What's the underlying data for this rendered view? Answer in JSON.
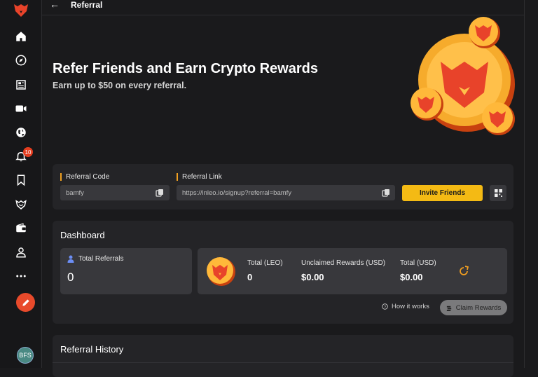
{
  "header": {
    "back_icon": "arrow-left-icon",
    "title": "Referral"
  },
  "sidebar": {
    "items": [
      {
        "name": "home",
        "icon": "home-icon"
      },
      {
        "name": "explore",
        "icon": "compass-icon"
      },
      {
        "name": "news",
        "icon": "newspaper-icon"
      },
      {
        "name": "video",
        "icon": "video-icon"
      },
      {
        "name": "globe",
        "icon": "globe-icon"
      },
      {
        "name": "notifications",
        "icon": "bell-icon"
      },
      {
        "name": "bookmarks",
        "icon": "bookmark-icon"
      },
      {
        "name": "leo",
        "icon": "leo-icon"
      },
      {
        "name": "wallet",
        "icon": "wallet-icon"
      },
      {
        "name": "profile",
        "icon": "user-icon"
      },
      {
        "name": "more",
        "icon": "more-icon"
      }
    ],
    "notification_count": "10",
    "avatar_text": "BFS",
    "accent": "#e84a2b"
  },
  "hero": {
    "title": "Refer Friends and Earn Crypto Rewards",
    "subtitle": "Earn up to $50 on every referral."
  },
  "referral": {
    "code_label": "Referral Code",
    "code_value": "bamfy",
    "link_label": "Referral Link",
    "link_value": "https://inleo.io/signup?referral=bamfy",
    "invite_label": "Invite Friends",
    "invite_color": "#f4ba14"
  },
  "dashboard": {
    "title": "Dashboard",
    "total_referrals_label": "Total Referrals",
    "total_referrals_value": "0",
    "total_leo_label": "Total (LEO)",
    "total_leo_value": "0",
    "unclaimed_label": "Unclaimed Rewards (USD)",
    "unclaimed_value": "$0.00",
    "total_usd_label": "Total (USD)",
    "total_usd_value": "$0.00",
    "how_label": "How it works",
    "claim_label": "Claim Rewards"
  },
  "history": {
    "title": "Referral History"
  }
}
